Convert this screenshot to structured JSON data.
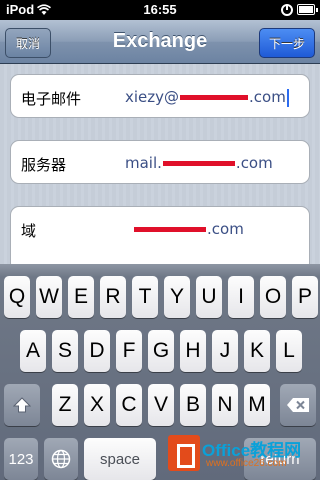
{
  "status_bar": {
    "carrier": "iPod",
    "time": "16:55"
  },
  "nav": {
    "title": "Exchange",
    "cancel_label": "取消",
    "next_label": "下一步"
  },
  "form": {
    "email": {
      "label": "电子邮件",
      "value_prefix": "xiezy@",
      "value_suffix": ".com"
    },
    "server": {
      "label": "服务器",
      "value_prefix": "mail.",
      "value_suffix": ".com"
    },
    "domain": {
      "label": "域",
      "value_prefix": "",
      "value_suffix": ".com"
    }
  },
  "keyboard": {
    "row1": [
      "Q",
      "W",
      "E",
      "R",
      "T",
      "Y",
      "U",
      "I",
      "O",
      "P"
    ],
    "row2": [
      "A",
      "S",
      "D",
      "F",
      "G",
      "H",
      "J",
      "K",
      "L"
    ],
    "row3": [
      "Z",
      "X",
      "C",
      "V",
      "B",
      "N",
      "M"
    ],
    "numbers_label": "123",
    "space_label": "space",
    "return_label": "return",
    "icons": {
      "shift": "shift-arrow-icon",
      "backspace": "backspace-icon",
      "globe": "globe-icon"
    }
  },
  "watermark": {
    "brand": "Office教程网",
    "url": "www.office26.com"
  }
}
